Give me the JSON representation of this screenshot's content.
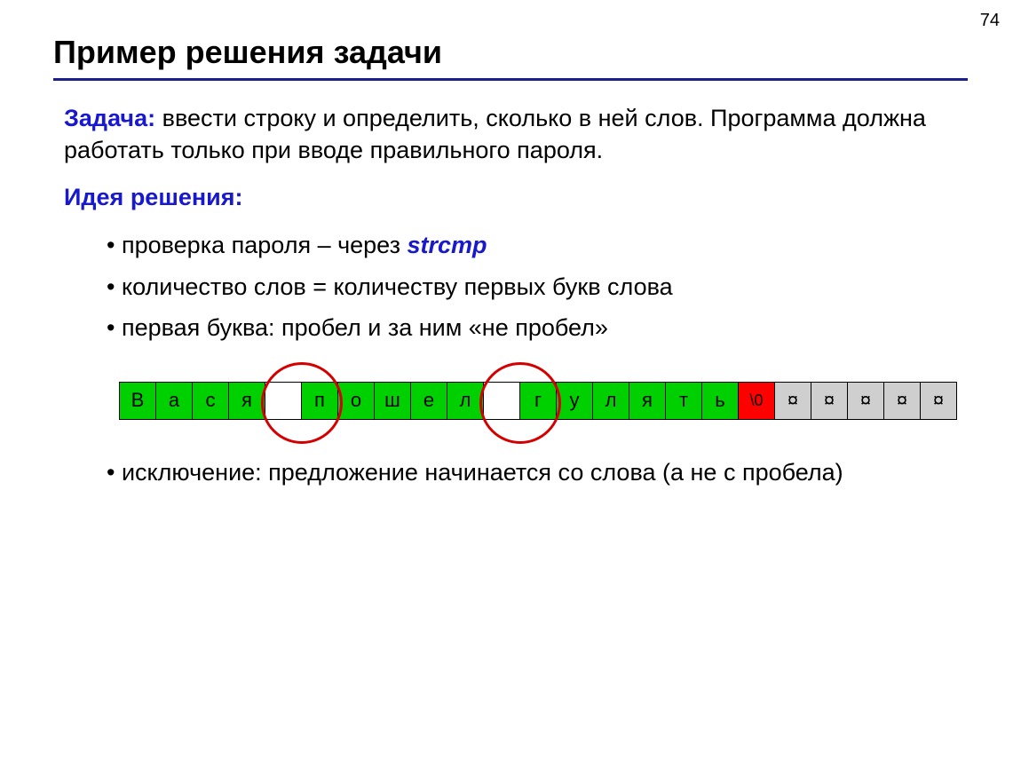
{
  "page_number": "74",
  "title": "Пример решения задачи",
  "task_label": "Задача:",
  "task_text": " ввести строку и определить, сколько в ней слов. Программа должна работать только при вводе правильного пароля.",
  "idea_label": "Идея решения:",
  "bullets": {
    "b1_pre": "проверка пароля – через ",
    "b1_code": "strcmp",
    "b2": "количество слов = количеству первых букв слова",
    "b3": "первая буква: пробел и за ним «не пробел»",
    "b4": "исключение: предложение начинается со слова (а не с пробела)"
  },
  "array": [
    {
      "ch": "В",
      "kind": "green"
    },
    {
      "ch": "а",
      "kind": "green"
    },
    {
      "ch": "с",
      "kind": "green"
    },
    {
      "ch": "я",
      "kind": "green"
    },
    {
      "ch": "",
      "kind": "white"
    },
    {
      "ch": "п",
      "kind": "green"
    },
    {
      "ch": "о",
      "kind": "green"
    },
    {
      "ch": "ш",
      "kind": "green"
    },
    {
      "ch": "е",
      "kind": "green"
    },
    {
      "ch": "л",
      "kind": "green"
    },
    {
      "ch": "",
      "kind": "white"
    },
    {
      "ch": "г",
      "kind": "green"
    },
    {
      "ch": "у",
      "kind": "green"
    },
    {
      "ch": "л",
      "kind": "green"
    },
    {
      "ch": "я",
      "kind": "green"
    },
    {
      "ch": "т",
      "kind": "green"
    },
    {
      "ch": "ь",
      "kind": "green"
    },
    {
      "ch": "\\0",
      "kind": "red"
    },
    {
      "ch": "¤",
      "kind": "gray"
    },
    {
      "ch": "¤",
      "kind": "gray"
    },
    {
      "ch": "¤",
      "kind": "gray"
    },
    {
      "ch": "¤",
      "kind": "gray"
    },
    {
      "ch": "¤",
      "kind": "gray"
    }
  ],
  "colors": {
    "green": "#00d000",
    "red": "#ff0000",
    "gray": "#cfcfcf",
    "accent_blue": "#1818cc",
    "rule_blue": "#1b1f8a",
    "circle_red": "#d40000"
  }
}
